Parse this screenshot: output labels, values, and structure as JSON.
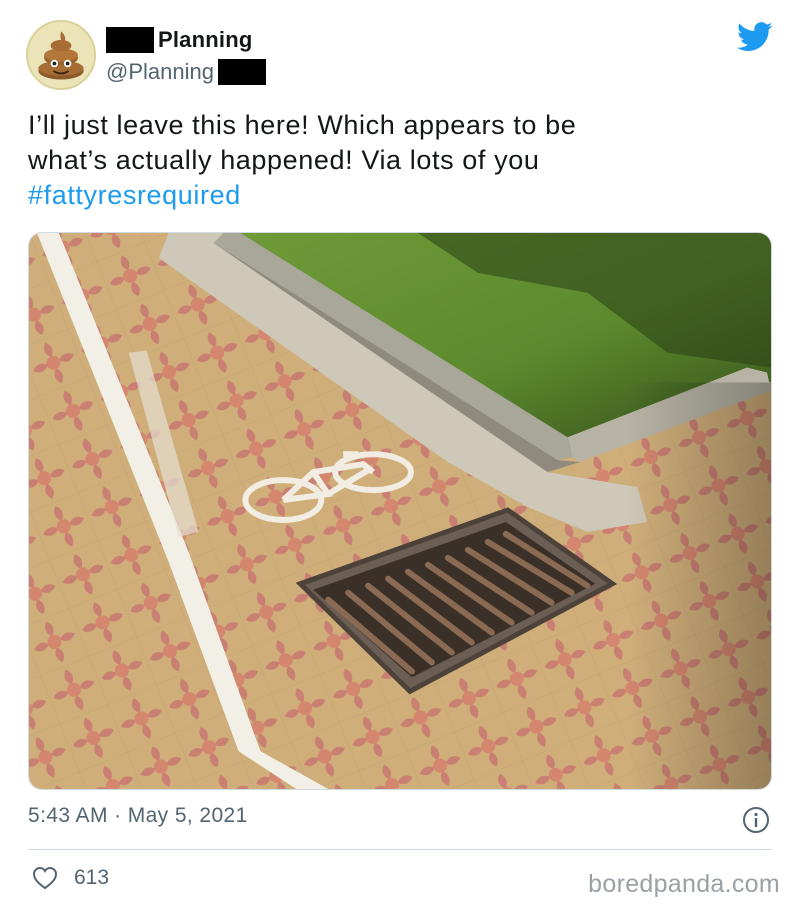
{
  "tweet": {
    "display_name": "Planning",
    "handle": "@Planning",
    "text_lines": [
      "I’ll just leave this here! Which appears to be",
      "what’s actually happened! Via lots of you"
    ],
    "hashtag": "#fattyresrequired",
    "timestamp": "5:43 AM · May 5, 2021",
    "like_count": "613"
  },
  "icons": {
    "avatar": "poop-emoji-avatar",
    "platform": "twitter-bird-icon",
    "info": "info-icon",
    "like": "heart-icon"
  },
  "colors": {
    "hashtag": "#1d9bf0",
    "twitter_blue": "#1d9bf0",
    "muted_text": "#536471"
  },
  "watermark": "boredpanda.com"
}
